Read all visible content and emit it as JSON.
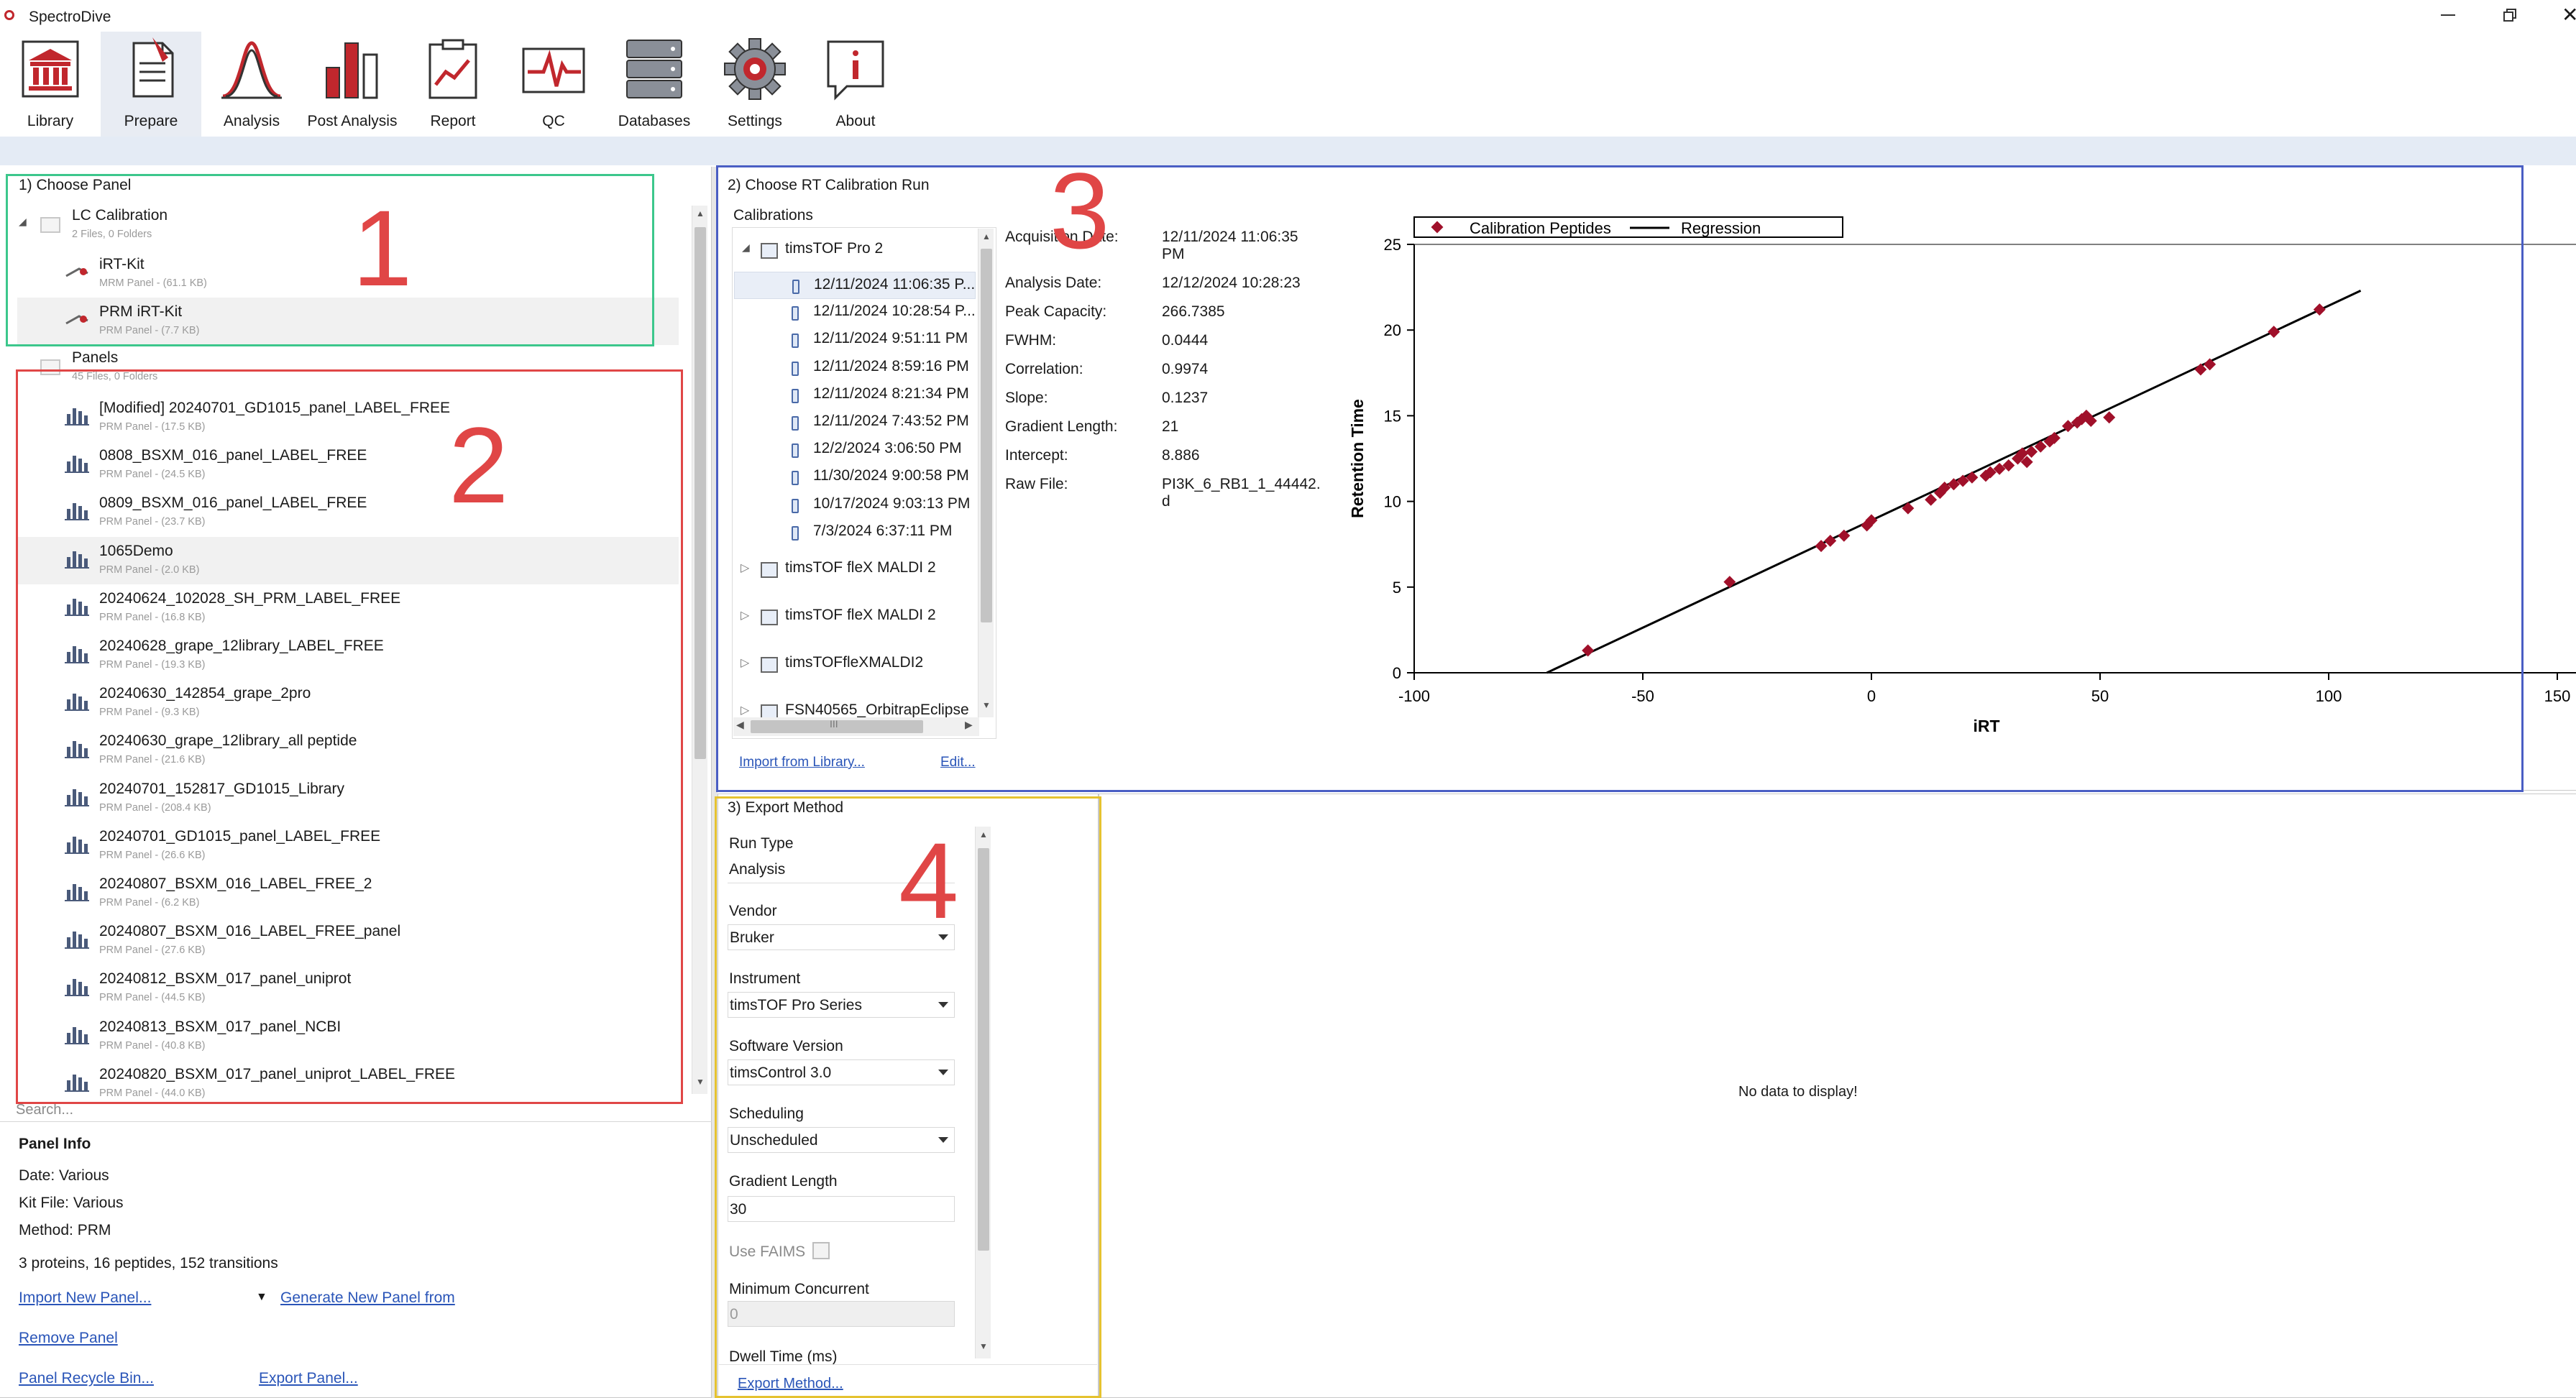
{
  "app": {
    "title": "SpectroDive"
  },
  "ribbon": [
    {
      "label": "Library",
      "icon": "library-icon"
    },
    {
      "label": "Prepare",
      "icon": "prepare-icon"
    },
    {
      "label": "Analysis",
      "icon": "analysis-icon"
    },
    {
      "label": "Post Analysis",
      "icon": "post-analysis-icon"
    },
    {
      "label": "Report",
      "icon": "report-icon"
    },
    {
      "label": "QC",
      "icon": "qc-icon"
    },
    {
      "label": "Databases",
      "icon": "databases-icon"
    },
    {
      "label": "Settings",
      "icon": "settings-icon"
    },
    {
      "label": "About",
      "icon": "about-icon"
    }
  ],
  "step_numbers": [
    "1",
    "2",
    "3",
    "4"
  ],
  "choose_panel": {
    "title": "1) Choose Panel",
    "lc_folder": {
      "name": "LC Calibration",
      "sub": "2 Files, 0 Folders"
    },
    "lc_items": [
      {
        "name": "iRT-Kit",
        "sub": "MRM Panel - (61.1 KB)"
      },
      {
        "name": "PRM iRT-Kit",
        "sub": "PRM Panel - (7.7 KB)"
      }
    ],
    "panels_folder": {
      "name": "Panels",
      "sub": "45 Files, 0 Folders"
    },
    "panels": [
      {
        "name": "[Modified] 20240701_GD1015_panel_LABEL_FREE",
        "sub": "PRM Panel - (17.5 KB)"
      },
      {
        "name": "0808_BSXM_016_panel_LABEL_FREE",
        "sub": "PRM Panel - (24.5 KB)"
      },
      {
        "name": "0809_BSXM_016_panel_LABEL_FREE",
        "sub": "PRM Panel - (23.7 KB)"
      },
      {
        "name": "1065Demo",
        "sub": "PRM Panel - (2.0 KB)"
      },
      {
        "name": "20240624_102028_SH_PRM_LABEL_FREE",
        "sub": "PRM Panel - (16.8 KB)"
      },
      {
        "name": "20240628_grape_12library_LABEL_FREE",
        "sub": "PRM Panel - (19.3 KB)"
      },
      {
        "name": "20240630_142854_grape_2pro",
        "sub": "PRM Panel - (9.3 KB)"
      },
      {
        "name": "20240630_grape_12library_all peptide",
        "sub": "PRM Panel - (21.6 KB)"
      },
      {
        "name": "20240701_152817_GD1015_Library",
        "sub": "PRM Panel - (208.4 KB)"
      },
      {
        "name": "20240701_GD1015_panel_LABEL_FREE",
        "sub": "PRM Panel - (26.6 KB)"
      },
      {
        "name": "20240807_BSXM_016_LABEL_FREE_2",
        "sub": "PRM Panel - (6.2 KB)"
      },
      {
        "name": "20240807_BSXM_016_LABEL_FREE_panel",
        "sub": "PRM Panel - (27.6 KB)"
      },
      {
        "name": "20240812_BSXM_017_panel_uniprot",
        "sub": "PRM Panel - (44.5 KB)"
      },
      {
        "name": "20240813_BSXM_017_panel_NCBI",
        "sub": "PRM Panel - (40.8 KB)"
      },
      {
        "name": "20240820_BSXM_017_panel_uniprot_LABEL_FREE",
        "sub": "PRM Panel - (44.0 KB)"
      }
    ],
    "search_placeholder": "Search...",
    "info": {
      "heading": "Panel Info",
      "date": "Date:  Various",
      "kit": "Kit File: Various",
      "method": "Method:  PRM",
      "summary": "3 proteins, 16 peptides, 152 transitions"
    },
    "links": {
      "import": "Import New Panel...",
      "generate": "Generate New Panel from",
      "remove": "Remove Panel",
      "recycle": "Panel Recycle Bin...",
      "export": "Export Panel..."
    }
  },
  "rt_calibration": {
    "title": "2) Choose RT Calibration Run",
    "calibrations_label": "Calibrations",
    "instrument": "timsTOF Pro 2",
    "runs": [
      "12/11/2024 11:06:35 P...",
      "12/11/2024 10:28:54 P...",
      "12/11/2024 9:51:11 PM",
      "12/11/2024 8:59:16 PM",
      "12/11/2024 8:21:34 PM",
      "12/11/2024 7:43:52 PM",
      "12/2/2024 3:06:50 PM",
      "11/30/2024 9:00:58 PM",
      "10/17/2024 9:03:13 PM",
      "7/3/2024 6:37:11 PM"
    ],
    "other_instruments": [
      "timsTOF fleX MALDI 2",
      "timsTOF fleX MALDI 2",
      "timsTOFfleXMALDI2",
      "FSN40565_OrbitrapEclipse"
    ],
    "scroll_mark": "III",
    "links": {
      "import": "Import from Library...",
      "edit": "Edit..."
    },
    "details": [
      {
        "label": "Acquisition Date:",
        "value": "12/11/2024 11:06:35",
        "value2": "PM"
      },
      {
        "label": "Analysis Date:",
        "value": "12/12/2024 10:28:23"
      },
      {
        "label": "Peak Capacity:",
        "value": "266.7385"
      },
      {
        "label": "FWHM:",
        "value": "0.0444"
      },
      {
        "label": "Correlation:",
        "value": "0.9974"
      },
      {
        "label": "Slope:",
        "value": "0.1237"
      },
      {
        "label": "Gradient Length:",
        "value": "21"
      },
      {
        "label": "Intercept:",
        "value": "8.886"
      },
      {
        "label": "Raw File:",
        "value": "PI3K_6_RB1_1_44442.",
        "value2": "d"
      }
    ]
  },
  "chart_data": {
    "type": "scatter",
    "xlabel": "iRT",
    "ylabel": "Retention Time",
    "xlim": [
      -100,
      150
    ],
    "ylim": [
      0,
      25
    ],
    "xticks": [
      -100,
      -50,
      0,
      50,
      100,
      150
    ],
    "yticks": [
      0,
      5,
      10,
      15,
      20,
      25
    ],
    "series": [
      {
        "name": "Calibration Peptides",
        "color": "#a0102a",
        "points": [
          [
            -62,
            1.3
          ],
          [
            -31,
            5.3
          ],
          [
            -11,
            7.4
          ],
          [
            -9,
            7.7
          ],
          [
            -6,
            8.0
          ],
          [
            -1,
            8.6
          ],
          [
            0,
            8.9
          ],
          [
            8,
            9.6
          ],
          [
            13,
            10.1
          ],
          [
            15,
            10.5
          ],
          [
            16,
            10.8
          ],
          [
            18,
            11.0
          ],
          [
            20,
            11.2
          ],
          [
            22,
            11.4
          ],
          [
            25,
            11.5
          ],
          [
            26,
            11.7
          ],
          [
            28,
            11.9
          ],
          [
            30,
            12.1
          ],
          [
            32,
            12.5
          ],
          [
            33,
            12.8
          ],
          [
            34,
            12.3
          ],
          [
            35,
            12.9
          ],
          [
            37,
            13.2
          ],
          [
            39,
            13.5
          ],
          [
            40,
            13.7
          ],
          [
            43,
            14.4
          ],
          [
            45,
            14.6
          ],
          [
            46,
            14.8
          ],
          [
            47,
            15.0
          ],
          [
            48,
            14.7
          ],
          [
            52,
            14.9
          ],
          [
            72,
            17.7
          ],
          [
            74,
            18.0
          ],
          [
            88,
            19.9
          ],
          [
            98,
            21.2
          ]
        ]
      },
      {
        "name": "Regression",
        "color": "#000000",
        "line": [
          [
            -71,
            0
          ],
          [
            107,
            22.3
          ]
        ]
      }
    ],
    "legend": "top"
  },
  "export_method": {
    "title": "3) Export Method",
    "run_type": {
      "label": "Run Type",
      "value": "Analysis"
    },
    "vendor": {
      "label": "Vendor",
      "value": "Bruker"
    },
    "instrument": {
      "label": "Instrument",
      "value": "timsTOF Pro Series"
    },
    "software": {
      "label": "Software Version",
      "value": "timsControl 3.0"
    },
    "scheduling": {
      "label": "Scheduling",
      "value": "Unscheduled"
    },
    "gradient": {
      "label": "Gradient Length",
      "value": "30"
    },
    "faims": {
      "label": "Use FAIMS"
    },
    "min_concurrent": {
      "label": "Minimum Concurrent",
      "value": "0"
    },
    "dwell": {
      "label": "Dwell Time (ms)"
    },
    "export_link": "Export Method...",
    "empty_message": "No data to display!"
  },
  "colors": {
    "box1": "#3cc78c",
    "box2": "#e04646",
    "box3": "#4a5ec4",
    "box4": "#e5c230",
    "link": "#2a55b8",
    "accent": "#c1272d"
  }
}
